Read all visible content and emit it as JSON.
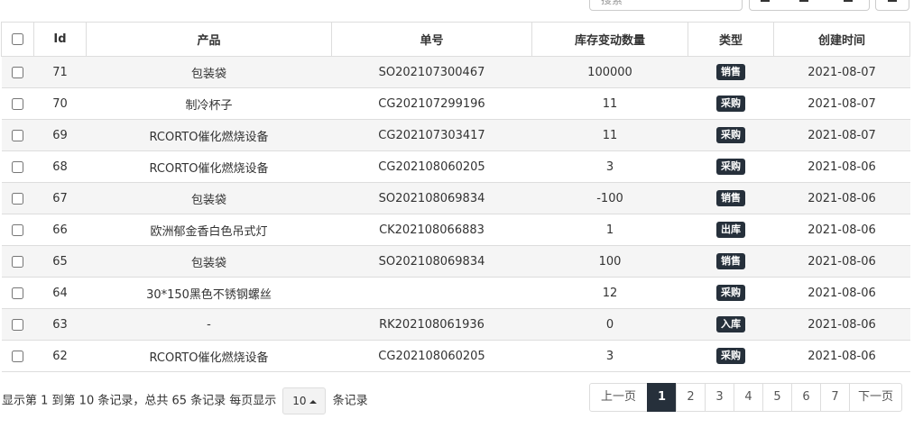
{
  "toolbar": {
    "search_placeholder": "搜索"
  },
  "table": {
    "headers": {
      "id": "Id",
      "product": "产品",
      "order_no": "单号",
      "quantity": "库存变动数量",
      "type": "类型",
      "created": "创建时间"
    },
    "rows": [
      {
        "id": "71",
        "product": "包装袋",
        "order_no": "SO202107300467",
        "quantity": "100000",
        "type": "销售",
        "created": "2021-08-07"
      },
      {
        "id": "70",
        "product": "制冷杯子",
        "order_no": "CG202107299196",
        "quantity": "11",
        "type": "采购",
        "created": "2021-08-07"
      },
      {
        "id": "69",
        "product": "RCORTO催化燃烧设备",
        "order_no": "CG202107303417",
        "quantity": "11",
        "type": "采购",
        "created": "2021-08-07"
      },
      {
        "id": "68",
        "product": "RCORTO催化燃烧设备",
        "order_no": "CG202108060205",
        "quantity": "3",
        "type": "采购",
        "created": "2021-08-06"
      },
      {
        "id": "67",
        "product": "包装袋",
        "order_no": "SO202108069834",
        "quantity": "-100",
        "type": "销售",
        "created": "2021-08-06"
      },
      {
        "id": "66",
        "product": "欧洲郁金香白色吊式灯",
        "order_no": "CK202108066883",
        "quantity": "1",
        "type": "出库",
        "created": "2021-08-06"
      },
      {
        "id": "65",
        "product": "包装袋",
        "order_no": "SO202108069834",
        "quantity": "100",
        "type": "销售",
        "created": "2021-08-06"
      },
      {
        "id": "64",
        "product": "30*150黑色不锈钢螺丝",
        "order_no": "",
        "quantity": "12",
        "type": "采购",
        "created": "2021-08-06"
      },
      {
        "id": "63",
        "product": "-",
        "order_no": "RK202108061936",
        "quantity": "0",
        "type": "入库",
        "created": "2021-08-06"
      },
      {
        "id": "62",
        "product": "RCORTO催化燃烧设备",
        "order_no": "CG202108060205",
        "quantity": "3",
        "type": "采购",
        "created": "2021-08-06"
      }
    ]
  },
  "pagination": {
    "info_prefix": "显示第 1 到第 10 条记录，总共 65 条记录 每页显示",
    "page_size": "10",
    "info_suffix": "条记录",
    "prev": "上一页",
    "pages": [
      "1",
      "2",
      "3",
      "4",
      "5",
      "6",
      "7"
    ],
    "next": "下一页",
    "active_page": "1"
  },
  "colors": {
    "badge": "#26303b",
    "stripe": "#f5f5f5",
    "border": "#dddddd"
  }
}
